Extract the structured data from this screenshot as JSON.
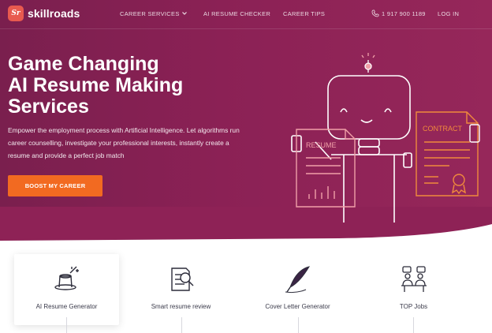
{
  "brand": {
    "name": "skillroads",
    "mark": "Sr"
  },
  "nav": {
    "links": [
      "CAREER SERVICES",
      "AI RESUME CHECKER",
      "CAREER TIPS"
    ],
    "phone": "1 917 900 1189",
    "login": "LOG IN"
  },
  "hero": {
    "title_lines": [
      "Game Changing",
      "AI Resume Making",
      "Services"
    ],
    "description": "Empower the employment process with Artificial Intelligence. Let algorithms run career counselling, investigate your professional interests, instantly create a resume and provide a perfect job match",
    "cta": "BOOST MY CAREER",
    "illustration": {
      "resume_label": "RESUME",
      "contract_label": "CONTRACT"
    }
  },
  "services": [
    {
      "label": "AI Resume Generator",
      "icon": "magic-hat-icon",
      "active": true
    },
    {
      "label": "Smart resume review",
      "icon": "document-magnifier-icon",
      "active": false
    },
    {
      "label": "Cover Letter Generator",
      "icon": "quill-pen-icon",
      "active": false
    },
    {
      "label": "TOP Jobs",
      "icon": "team-meeting-icon",
      "active": false
    }
  ],
  "colors": {
    "hero_bg": "#8b2155",
    "accent": "#f26a21",
    "logo": "#e85a4f",
    "illustration_orange": "#f08a3c",
    "illustration_pink": "#f0a0a8"
  }
}
